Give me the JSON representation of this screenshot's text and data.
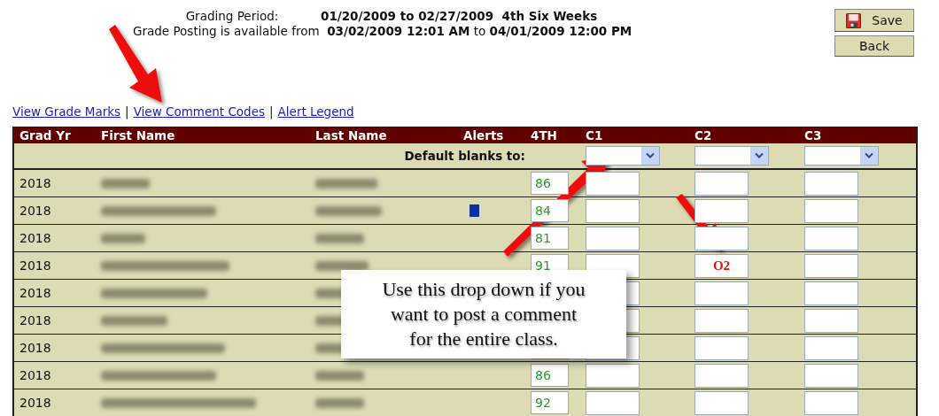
{
  "header": {
    "period_label": "Grading Period:",
    "period_value": "01/20/2009 to 02/27/2009  4th Six Weeks",
    "posting": "Grade Posting is available from  **03/02/2009 12:01 AM** to **04/01/2009 12:00 PM**"
  },
  "buttons": [
    {
      "label": "Save",
      "kind": "save"
    },
    {
      "label": "Back",
      "kind": "plain"
    }
  ],
  "links": [
    {
      "label": "View Grade Marks"
    },
    {
      "label": "View Comment Codes"
    },
    {
      "label": "Alert Legend"
    }
  ],
  "link_separators": [
    "|",
    "|"
  ],
  "table": {
    "columns": [
      "Grad Yr",
      "First Name",
      "Last Name",
      "Alerts",
      "4TH",
      "C1",
      "C2",
      "C3"
    ],
    "default_label": "Default blanks to:",
    "rows": [
      {
        "grad_yr": "2018",
        "alert": false,
        "grade": "86"
      },
      {
        "grad_yr": "2018",
        "alert": true,
        "grade": "84"
      },
      {
        "grad_yr": "2018",
        "alert": false,
        "grade": "81"
      },
      {
        "grad_yr": "2018",
        "alert": false,
        "grade": "91",
        "c2": "O2"
      },
      {
        "grad_yr": "2018",
        "alert": false
      },
      {
        "grad_yr": "2018",
        "alert": false
      },
      {
        "grad_yr": "2018",
        "alert": false
      },
      {
        "grad_yr": "2018",
        "alert": false,
        "grade": "86"
      },
      {
        "grad_yr": "2018",
        "alert": false,
        "grade": "92"
      }
    ]
  },
  "callout": {
    "lines": [
      "Use this drop down if you",
      "want to post a comment",
      "for the entire class."
    ]
  }
}
